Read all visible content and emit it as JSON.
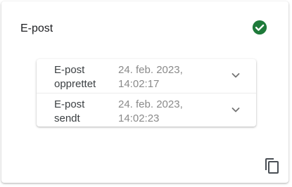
{
  "card": {
    "title": "E-post",
    "status_icon": "check-circle-icon",
    "status_color": "#1e7a3a"
  },
  "events": [
    {
      "label_line1": "E-post",
      "label_line2": "opprettet",
      "time_line1": "24. feb. 2023,",
      "time_line2": "14:02:17",
      "expand_icon": "chevron-down-icon"
    },
    {
      "label_line1": "E-post",
      "label_line2": "sendt",
      "time_line1": "24. feb. 2023,",
      "time_line2": "14:02:23",
      "expand_icon": "chevron-down-icon"
    }
  ],
  "actions": {
    "copy_icon": "copy-icon"
  }
}
